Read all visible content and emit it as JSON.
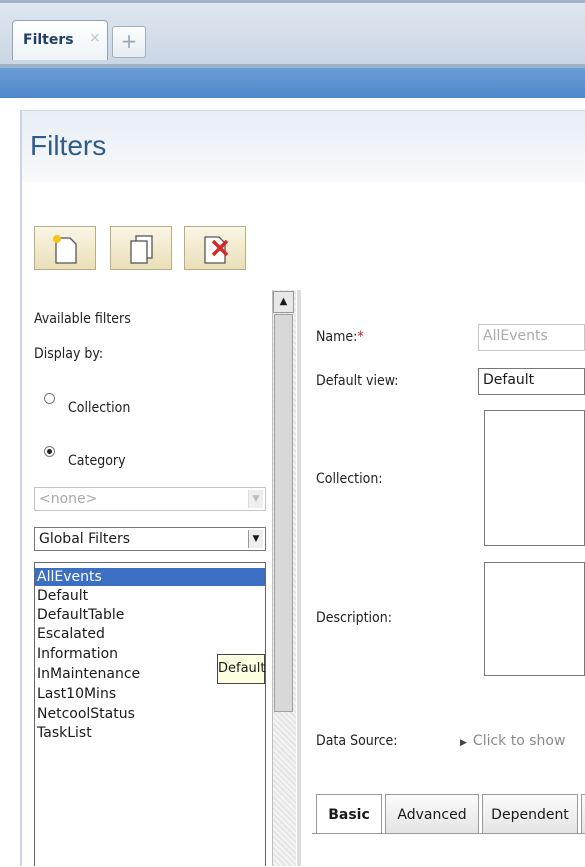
{
  "tabs": {
    "active_label": "Filters",
    "close": "×",
    "add": "+"
  },
  "page": {
    "title": "Filters"
  },
  "left": {
    "available_filters": "Available filters",
    "display_by": "Display by:",
    "radio_collection": "Collection",
    "radio_category": "Category",
    "collection_select": "<none>",
    "category_select": "Global Filters",
    "filters": [
      "AllEvents",
      "Default",
      "DefaultTable",
      "Escalated",
      "Information",
      "InMaintenance",
      "Last10Mins",
      "NetcoolStatus",
      "TaskList"
    ],
    "tooltip": "Default"
  },
  "form": {
    "name_label": "Name:",
    "required": "*",
    "name_value": "AllEvents",
    "default_view_label": "Default view:",
    "default_view_value": "Default",
    "collection_label": "Collection:",
    "description_label": "Description:",
    "data_source_label": "Data Source:",
    "data_source_link": "Click to show"
  },
  "bottom_tabs": [
    "Basic",
    "Advanced",
    "Dependent"
  ],
  "colors": {
    "accent": "#4f86c8",
    "selection": "#3c6fc4",
    "title": "#2f5c8a"
  }
}
